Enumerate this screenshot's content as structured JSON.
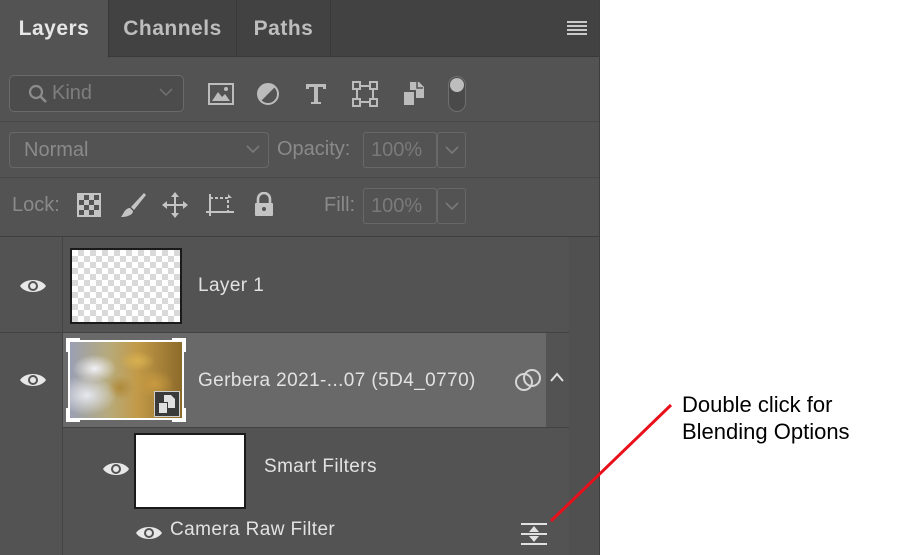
{
  "tabs": [
    {
      "label": "Layers",
      "active": true
    },
    {
      "label": "Channels",
      "active": false
    },
    {
      "label": "Paths",
      "active": false
    }
  ],
  "filter": {
    "kind_placeholder": "Kind",
    "icons": [
      "image-filter-icon",
      "adjustment-filter-icon",
      "type-filter-icon",
      "shape-filter-icon",
      "smart-object-filter-icon"
    ]
  },
  "blend": {
    "mode": "Normal",
    "opacity_label": "Opacity:",
    "opacity_value": "100%",
    "lock_label": "Lock:",
    "fill_label": "Fill:",
    "fill_value": "100%"
  },
  "layers": [
    {
      "name": "Layer 1",
      "visible": true,
      "thumbnail": "transparent"
    },
    {
      "name": "Gerbera 2021-...07 (5D4_0770)",
      "visible": true,
      "thumbnail": "photo",
      "selected": true,
      "smart_object": true
    },
    {
      "name": "Smart Filters",
      "visible": true,
      "thumbnail": "white-mask"
    },
    {
      "name": "Camera Raw Filter",
      "visible": true
    }
  ],
  "annotation": {
    "line1": "Double click for",
    "line2": "Blending Options",
    "color": "#e8101a"
  },
  "colors": {
    "panel_bg": "#535353",
    "tabbar_bg": "#424242",
    "selected_row": "#696969",
    "text": "#e2e2e2"
  }
}
